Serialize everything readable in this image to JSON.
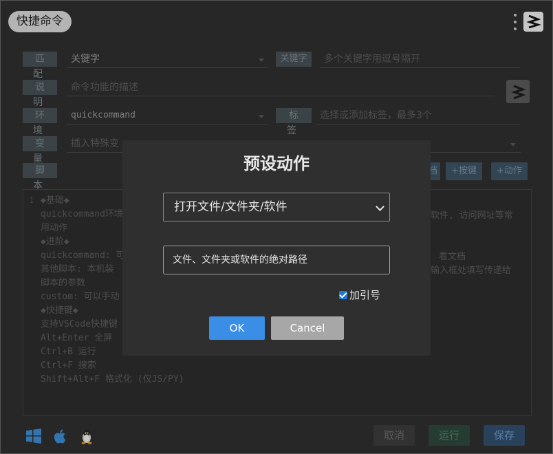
{
  "header": {
    "title": "快捷命令",
    "more_icon": "more-vertical-icon",
    "logo_icon": "quickcommand-logo-icon"
  },
  "form": {
    "match": {
      "label": "匹 配",
      "value": "关键字"
    },
    "keyword": {
      "label": "关键字",
      "placeholder": "多个关键字用逗号隔开"
    },
    "description": {
      "label": "说 明",
      "placeholder": "命令功能的描述"
    },
    "environment": {
      "label": "环 境",
      "value": "quickcommand"
    },
    "tags": {
      "label": "标 签",
      "placeholder": "选择或添加标签，最多3个"
    },
    "variables": {
      "label": "变 量",
      "placeholder": "插入特殊变"
    },
    "script": {
      "label": "脚 本"
    },
    "buttons": {
      "partial_left": "档",
      "add_key": "+按键",
      "add_action": "+动作"
    }
  },
  "editor": {
    "line_number": "1",
    "lines": [
      "◆基础◆",
      "quickcommand环境",
      "用动作",
      "◆进阶◆",
      "quickcommand: 可",
      "其他脚本: 本机装",
      "脚本的参数",
      "custom: 可以手动",
      "◆快捷键◆",
      "支持VSCode快捷键",
      "Alt+Enter 全屏",
      "Ctrl+B 运行",
      "Ctrl+F 搜索",
      "Shift+Alt+F 格式化 (仅JS/PY)"
    ],
    "right_fragments": [
      "软件, 访问网址等常",
      "看文档",
      "输入框处填写传递给"
    ]
  },
  "footer": {
    "os_icons": [
      "windows-icon",
      "apple-icon",
      "linux-icon"
    ],
    "cancel_label": "取消",
    "run_label": "运行",
    "save_label": "保存"
  },
  "modal": {
    "title": "预设动作",
    "action_select_value": "打开文件/文件夹/软件",
    "path_input_placeholder": "文件、文件夹或软件的绝对路径",
    "add_quotes_label": "加引号",
    "add_quotes_checked": true,
    "ok_label": "OK",
    "cancel_label": "Cancel"
  },
  "colors": {
    "accent_blue": "#3a8ee6",
    "run_green": "#3c5a4c",
    "save_blue": "#3f5f84"
  }
}
